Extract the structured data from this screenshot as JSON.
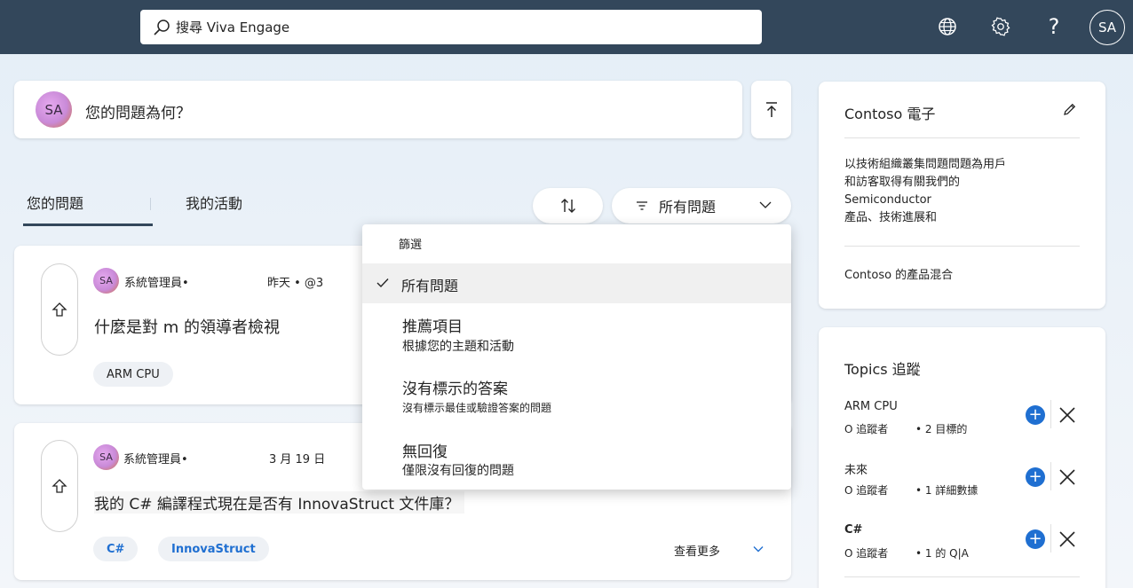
{
  "header": {
    "search_placeholder": "搜尋 Viva Engage",
    "avatar_initials": "SA"
  },
  "composer": {
    "avatar_initials": "SA",
    "prompt": "您的問題為何？"
  },
  "tabs": [
    {
      "label": "您的問題",
      "active": true
    },
    {
      "label": "我的活動",
      "active": false
    }
  ],
  "filter": {
    "selected_label": "所有問題"
  },
  "dropdown": {
    "heading": "篩選",
    "items": [
      {
        "label": "所有問題",
        "description": "",
        "selected": true
      },
      {
        "label": "推薦項目",
        "description": "根據您的主題和活動",
        "selected": false
      },
      {
        "label": "沒有標示的答案",
        "description": "沒有標示最佳或驗證答案的問題",
        "selected": false
      },
      {
        "label": "無回復",
        "description": "僅限沒有回復的問題",
        "selected": false
      }
    ]
  },
  "posts": [
    {
      "avatar_initials": "SA",
      "author": "系統管理員•",
      "meta": "昨天 • @3",
      "title": "什麼是對 m 的領導者檢視",
      "tags": [
        "ARM CPU"
      ]
    },
    {
      "avatar_initials": "SA",
      "author": "系統管理員•",
      "meta": "3 月 19 日",
      "title": "我的 C# 編譯程式現在是否有 InnovaStruct 文件庫？",
      "tags": [
        "C#",
        "InnovaStruct"
      ],
      "see_more": "查看更多"
    }
  ],
  "community": {
    "name": "Contoso 電子",
    "description_lines": [
      "以技術組織叢集問題問題為用戶",
      "和訪客取得有關我們的",
      "Semiconductor",
      "產品、技術進展和"
    ],
    "link": "Contoso 的產品混合"
  },
  "topics": {
    "title": "Topics 追蹤",
    "items": [
      {
        "name": "ARM CPU",
        "followers": "O 追蹤者",
        "stat": "• 2 目標的"
      },
      {
        "name": "未來",
        "followers": "O 追蹤者",
        "stat": "• 1 詳細數據"
      },
      {
        "name": "C#",
        "followers": "O 追蹤者",
        "stat": "• 1 的 Q|A"
      }
    ]
  },
  "colors": {
    "topbar": "#33475b",
    "accent": "#1f6fd1",
    "tag_text_accent": "#1f6fd1"
  }
}
